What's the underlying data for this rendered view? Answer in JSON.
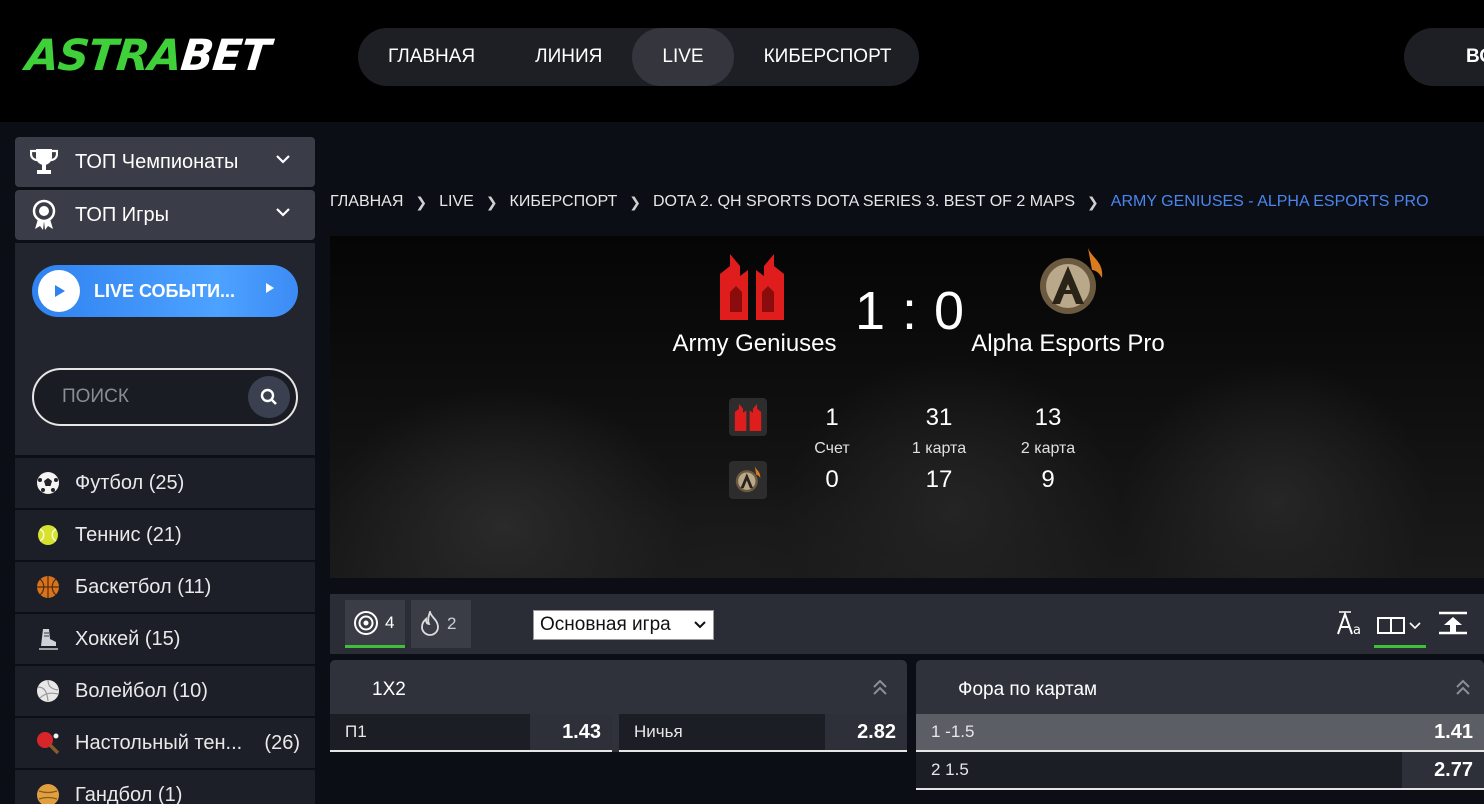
{
  "header": {
    "logo_part1": "ASTRA",
    "logo_part2": "BET",
    "nav": [
      {
        "label": "ГЛАВНАЯ",
        "active": false
      },
      {
        "label": "ЛИНИЯ",
        "active": false
      },
      {
        "label": "LIVE",
        "active": true
      },
      {
        "label": "КИБЕРСПОРТ",
        "active": false
      }
    ],
    "login_fragment": "ВО"
  },
  "sidebar": {
    "top_championships": "ТОП Чемпионаты",
    "top_games": "ТОП Игры",
    "live_button": "LIVE СОБЫТИ...",
    "search_placeholder": "ПОИСК",
    "sports": [
      {
        "name": "Футбол (25)",
        "count": "",
        "icon": "soccer-ball-icon"
      },
      {
        "name": "Теннис (21)",
        "count": "",
        "icon": "tennis-ball-icon"
      },
      {
        "name": "Баскетбол (11)",
        "count": "",
        "icon": "basketball-icon"
      },
      {
        "name": "Хоккей (15)",
        "count": "",
        "icon": "ice-skate-icon"
      },
      {
        "name": "Волейбол (10)",
        "count": "",
        "icon": "volleyball-icon"
      },
      {
        "name": "Настольный тен...",
        "count": "(26)",
        "icon": "ping-pong-icon"
      },
      {
        "name": "Гандбол (1)",
        "count": "",
        "icon": "handball-icon"
      }
    ]
  },
  "breadcrumb": [
    "ГЛАВНАЯ",
    "LIVE",
    "КИБЕРСПОРТ",
    "DOTA 2. QH SPORTS DOTA SERIES 3. BEST OF 2 MAPS",
    "ARMY GENIUSES - ALPHA ESPORTS PRO"
  ],
  "match": {
    "team_a": "Army Geniuses",
    "team_b": "Alpha Esports Pro",
    "score": "1 : 0",
    "stats": {
      "labels": [
        "Счет",
        "1 карта",
        "2 карта"
      ],
      "team_a": [
        "1",
        "31",
        "13"
      ],
      "team_b": [
        "0",
        "17",
        "9"
      ]
    }
  },
  "markets_toolbar": {
    "tab_all_count": "4",
    "tab_hot_count": "2",
    "select_value": "Основная игра"
  },
  "markets": {
    "m1x2": {
      "title": "1X2",
      "outcomes": [
        {
          "label": "П1",
          "odd": "1.43"
        },
        {
          "label": "Ничья",
          "odd": "2.82"
        }
      ]
    },
    "handicap": {
      "title": "Фора по картам",
      "outcomes": [
        {
          "label": "1 -1.5",
          "odd": "1.41"
        },
        {
          "label": "2 1.5",
          "odd": "2.77"
        }
      ]
    }
  },
  "colors": {
    "brand_green": "#3fd03a",
    "accent_blue": "#4a86f0",
    "active_tab_green": "#3fbf3a"
  }
}
